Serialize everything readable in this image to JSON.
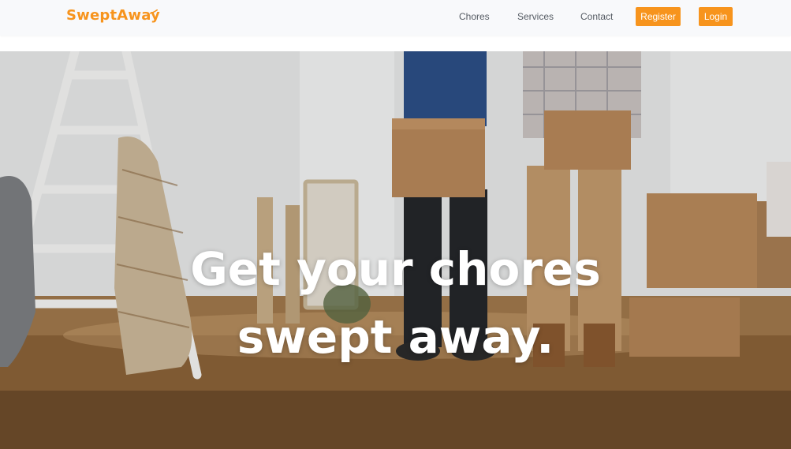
{
  "app": {
    "logo_text": "SweptAway"
  },
  "nav": {
    "links": [
      {
        "label": "Chores"
      },
      {
        "label": "Services"
      },
      {
        "label": "Contact"
      }
    ],
    "register_label": "Register",
    "login_label": "Login"
  },
  "hero": {
    "headline_line1": "Get your chores",
    "headline_line2": "swept away.",
    "image": "people-holding-moving-boxes-photo"
  },
  "colors": {
    "brand": "#f7941d",
    "nav_text": "#555b63",
    "topbar_bg": "#f8f9fb"
  }
}
